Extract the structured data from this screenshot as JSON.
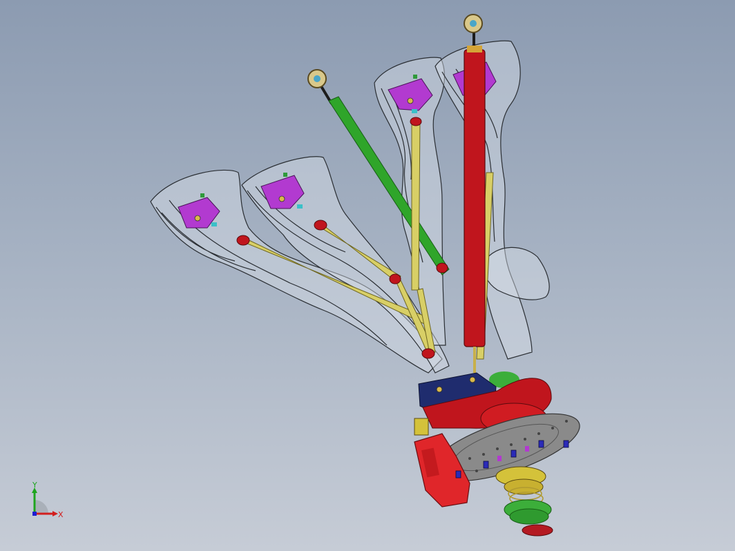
{
  "viewport": {
    "model_name": "suspension-upright-assembly",
    "colors": {
      "background_top": "#8c9bb1",
      "background_bottom": "#c6ccd6",
      "duct_fill": "#d7dde6",
      "duct_edges": "#2a2e33",
      "pushrod_yellow": "#d8cf66",
      "damper_red": "#c0151d",
      "tie_rod_green": "#2fa52a",
      "mount_magenta": "#b23ad0",
      "bracket_navy": "#1f2c6e",
      "caliper_red": "#e0262a",
      "disc_grey": "#8a8a8a",
      "bolt_blue": "#2a2ab8",
      "hub_yellow": "#d4c23a",
      "hub_green": "#3cae3a"
    }
  },
  "triad": {
    "x_label": "X",
    "y_label": "Y",
    "x_color": "#d21e1e",
    "y_color": "#1ea51e",
    "z_color": "#1e1ed2"
  }
}
